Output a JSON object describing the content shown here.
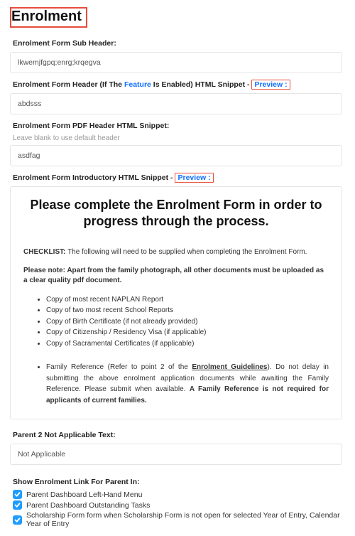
{
  "title": "Enrolment",
  "sub_header": {
    "label": "Enrolment Form Sub Header:",
    "value": "lkwemjfgpq;enrg;krqegva"
  },
  "header": {
    "label_pre": "Enrolment Form Header (If The ",
    "label_link": "Feature",
    "label_post": " Is Enabled) HTML Snippet -",
    "preview": "Preview :",
    "value": "abdsss"
  },
  "pdf_header": {
    "label": "Enrolment Form PDF Header HTML Snippet:",
    "hint": "Leave blank to use default header",
    "value": "asdfag"
  },
  "intro": {
    "label": "Enrolment Form Introductory HTML Snippet -",
    "preview": "Preview :",
    "heading": "Please complete the Enrolment Form in order to progress through the process.",
    "checklist_lead": "CHECKLIST:",
    "checklist_text": " The following will need to be supplied when completing the Enrolment Form.",
    "please_note_lead": "Please note: Apart from the family photograph, all other documents must be uploaded as a clear quality pdf document.",
    "items": [
      "Copy of most recent NAPLAN Report",
      "Copy of two most recent School Reports",
      "Copy of Birth Certificate (if not already provided)",
      "Copy of Citizenship / Residency Visa (if applicable)",
      "Copy of Sacramental Certificates (if applicable)"
    ],
    "ref_pre": "Family Reference (Refer to point 2 of the ",
    "ref_link": "Enrolment Guidelines",
    "ref_mid": "). Do not delay in submitting the above enrolment application documents while awaiting the Family Reference. Please submit when available. ",
    "ref_bold": "A Family Reference is not required for applicants of current families."
  },
  "parent2": {
    "label": "Parent 2 Not Applicable Text:",
    "value": "Not Applicable"
  },
  "show_link": {
    "label": "Show Enrolment Link For Parent In:",
    "options": [
      "Parent Dashboard Left-Hand Menu",
      "Parent Dashboard Outstanding Tasks",
      "Scholarship Form form when Scholarship Form is not open for selected Year of Entry, Calendar Year of Entry"
    ]
  }
}
